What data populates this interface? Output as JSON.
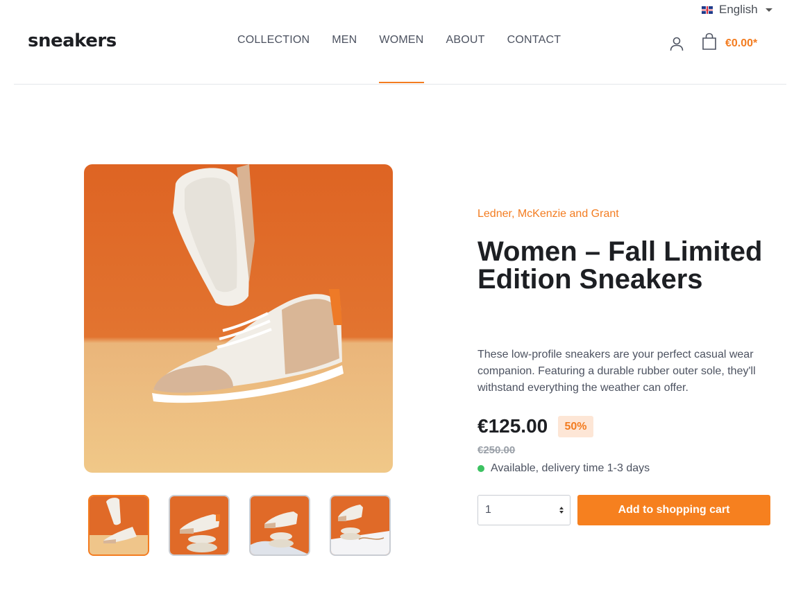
{
  "language": {
    "label": "English",
    "flag_icon": "uk-flag-icon"
  },
  "header": {
    "logo": "sneakers",
    "nav": [
      {
        "label": "COLLECTION",
        "active": false
      },
      {
        "label": "MEN",
        "active": false
      },
      {
        "label": "WOMEN",
        "active": true
      },
      {
        "label": "ABOUT",
        "active": false
      },
      {
        "label": "CONTACT",
        "active": false
      }
    ],
    "account_icon": "user-icon",
    "cart_icon": "shopping-bag-icon",
    "cart_total": "€0.00*"
  },
  "gallery": {
    "selected_index": 0,
    "thumbnail_count": 4
  },
  "product": {
    "manufacturer": "Ledner, McKenzie and Grant",
    "title": "Women – Fall Limited Edition Sneakers",
    "description": "These low-profile sneakers are your perfect casual wear companion. Featuring a durable rubber outer sole, they'll withstand everything the weather can offer.",
    "price": "€125.00",
    "discount_badge": "50%",
    "old_price": "€250.00",
    "availability": "Available, delivery time 1-3 days",
    "quantity": "1",
    "add_to_cart_label": "Add to shopping cart"
  },
  "colors": {
    "accent": "#f37c20",
    "text": "#1d1f23",
    "muted": "#4c5260",
    "available": "#3cc261"
  }
}
